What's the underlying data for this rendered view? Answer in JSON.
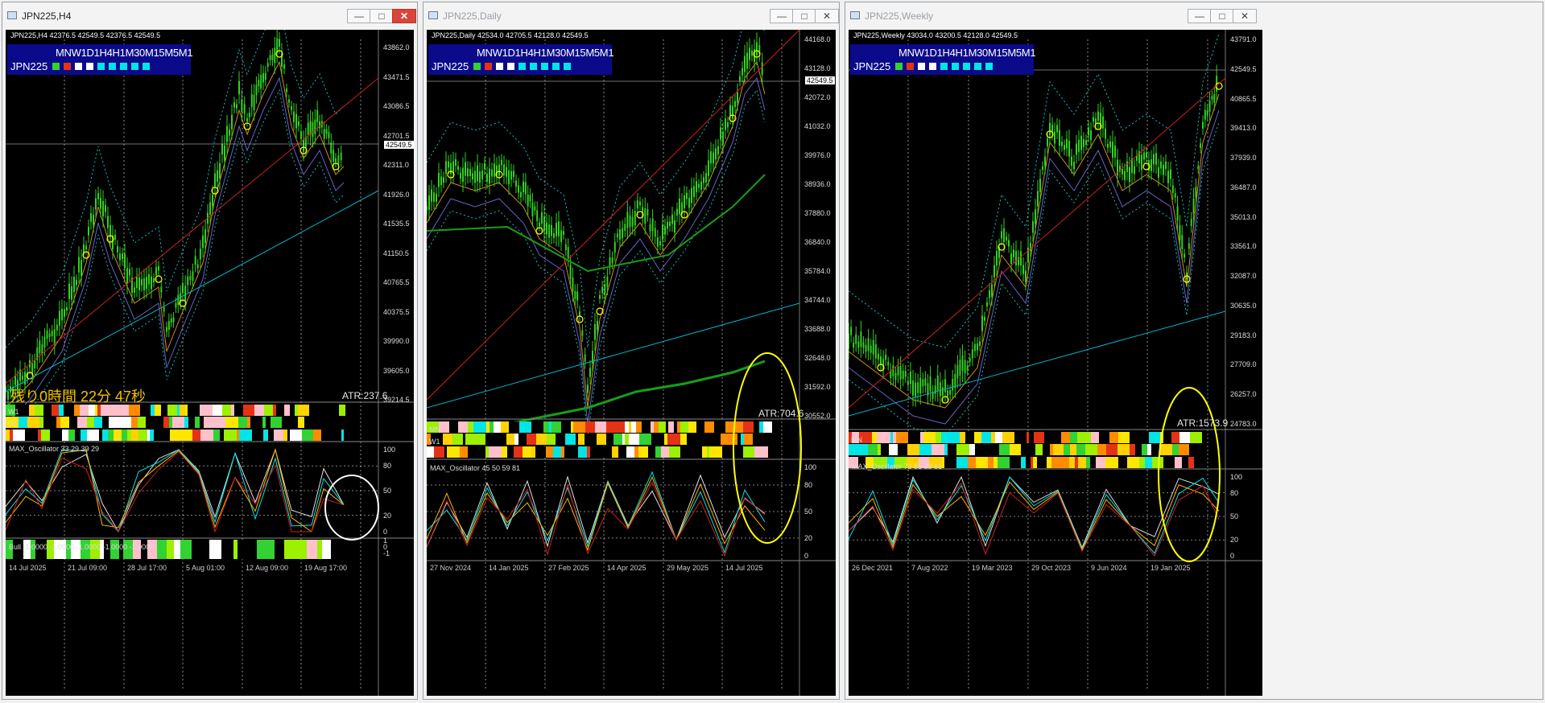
{
  "colors": {
    "candle": "#32d21e",
    "bollinger": "#00c8c8",
    "trend_red": "#d21e1e",
    "trend_cyan": "#00b4c8",
    "annot_white": "#ffffff",
    "annot_yellow": "#ffff00",
    "timer_text": "#f0c000",
    "panel_bg": "#0a0a8a"
  },
  "mtf_labels": {
    "tf_text": "MNW1D1H4H1M30M15M5M1",
    "symbol": "JPN225"
  },
  "windows": [
    {
      "title": "JPN225,H4",
      "header": "JPN225,H4  42376.5 42549.5 42376.5 42549.5",
      "mtf_squares": [
        "#32d232",
        "#e63214",
        "#ffffff",
        "#ffffff",
        "#00e6e6",
        "#00e6e6",
        "#00e6e6",
        "#00e6e6",
        "#00e6e6"
      ],
      "price_levels": [
        "43862.0",
        "43471.5",
        "43086.5",
        "42701.5",
        "42311.0",
        "41926.0",
        "41535.5",
        "41150.5",
        "40765.5",
        "40375.5",
        "39990.0",
        "39605.0",
        "39214.5"
      ],
      "current_price": "42549.5",
      "atr": "ATR:237.6",
      "timer": "残り0時間 22分 47秒",
      "strip_labels": [
        "W1",
        "D1",
        ""
      ],
      "oscillator_label": "MAX_Oscillator 33 29 39 29",
      "osc_scale": [
        "100",
        "80",
        "50",
        "20",
        "0"
      ],
      "bottom_label": "Bull -1.0000 -1.0000 -1.0000 -1.0000 -1.0000",
      "bottom_scale": [
        "1",
        "0",
        "-1"
      ],
      "dates": [
        "14 Jul 2025",
        "21 Jul 09:00",
        "28 Jul 17:00",
        "5 Aug 01:00",
        "12 Aug 09:00",
        "19 Aug 17:00"
      ]
    },
    {
      "title": "JPN225,Daily",
      "header": "JPN225,Daily  42534.0 42705.5 42128.0 42549.5",
      "mtf_squares": [
        "#32d232",
        "#e63214",
        "#ffffff",
        "#ffffff",
        "#00e6e6",
        "#00e6e6",
        "#00e6e6",
        "#00e6e6",
        "#00e6e6"
      ],
      "price_levels": [
        "44168.0",
        "43128.0",
        "42072.0",
        "41032.0",
        "39976.0",
        "38936.0",
        "37880.0",
        "36840.0",
        "35784.0",
        "34744.0",
        "33688.0",
        "32648.0",
        "31592.0",
        "30552.0"
      ],
      "current_price": "42549.5",
      "atr": "ATR:704.6",
      "strip_labels": [
        "MN",
        "W1",
        ""
      ],
      "oscillator_label": "MAX_Oscillator 45 50 59 81",
      "osc_scale": [
        "100",
        "80",
        "50",
        "20",
        "0"
      ],
      "dates": [
        "27 Nov 2024",
        "14 Jan 2025",
        "27 Feb 2025",
        "14 Apr 2025",
        "29 May 2025",
        "14 Jul 2025"
      ]
    },
    {
      "title": "JPN225,Weekly",
      "header": "JPN225,Weekly  43034.0 43200.5 42128.0 42549.5",
      "mtf_squares": [
        "#32d232",
        "#e63214",
        "#ffffff",
        "#ffffff",
        "#00e6e6",
        "#00e6e6",
        "#00e6e6",
        "#00e6e6",
        "#00e6e6"
      ],
      "price_levels": [
        "43791.0",
        "42549.5",
        "40865.5",
        "39413.0",
        "37939.0",
        "36487.0",
        "35013.0",
        "33561.0",
        "32087.0",
        "30635.0",
        "29183.0",
        "27709.0",
        "26257.0",
        "24783.0"
      ],
      "current_price": "42549.5",
      "atr": "ATR:1573.9",
      "strip_labels": [
        "MN",
        ""
      ],
      "oscillator_label": "MAX_Oscillator 72 81 89 61",
      "osc_scale": [
        "100",
        "80",
        "50",
        "20",
        "0"
      ],
      "dates": [
        "26 Dec 2021",
        "7 Aug 2022",
        "19 Mar 2023",
        "29 Oct 2023",
        "9 Jun 2024",
        "19 Jan 2025"
      ]
    }
  ]
}
